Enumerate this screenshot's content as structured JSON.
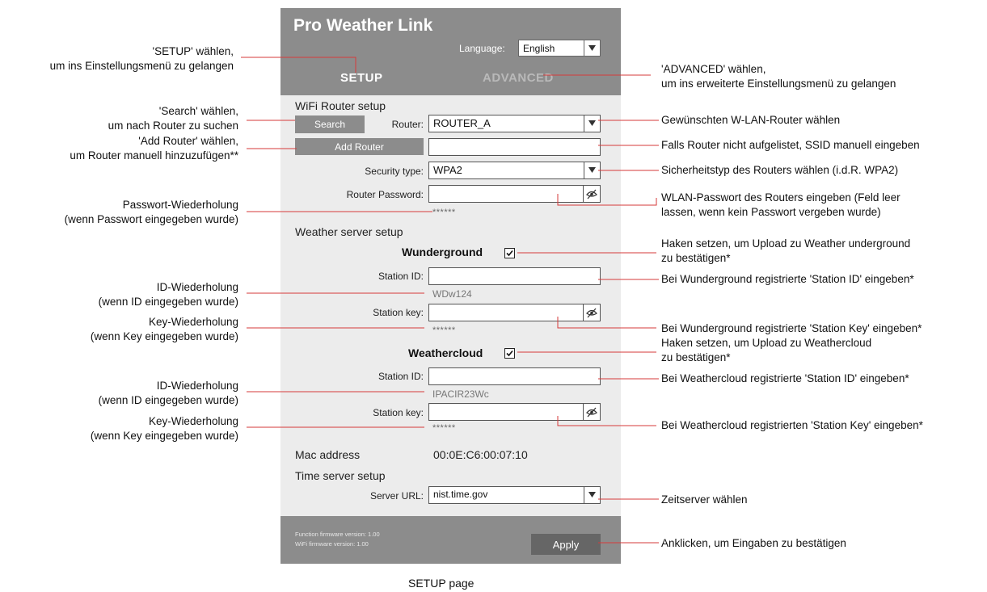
{
  "panel": {
    "title": "Pro Weather Link",
    "language_label": "Language:",
    "language_value": "English",
    "tabs": {
      "setup": "SETUP",
      "advanced": "ADVANCED"
    },
    "wifi": {
      "heading": "WiFi Router setup",
      "search_button": "Search",
      "router_label": "Router:",
      "router_value": "ROUTER_A",
      "add_router_button": "Add Router",
      "ssid_value": "",
      "security_label": "Security type:",
      "security_value": "WPA2",
      "password_label": "Router Password:",
      "password_echo": "******"
    },
    "weather": {
      "heading": "Weather server setup",
      "wunderground": {
        "name": "Wunderground",
        "checked": true,
        "station_id_label": "Station ID:",
        "station_id_echo": "WDw124",
        "station_key_label": "Station key:",
        "station_key_echo": "******"
      },
      "weathercloud": {
        "name": "Weathercloud",
        "checked": true,
        "station_id_label": "Station ID:",
        "station_id_echo": "IPACIR23Wc",
        "station_key_label": "Station key:",
        "station_key_echo": "******"
      }
    },
    "mac": {
      "label": "Mac address",
      "value": "00:0E:C6:00:07:10"
    },
    "time": {
      "heading": "Time server setup",
      "server_label": "Server URL:",
      "server_value": "nist.time.gov"
    },
    "footer": {
      "function_fw": "Function firmware version: 1.00",
      "wifi_fw": "WiFi firmware version: 1.00",
      "apply_button": "Apply"
    }
  },
  "annotations": {
    "left": {
      "setup": [
        "'SETUP' wählen,",
        "um ins Einstellungsmenü zu gelangen"
      ],
      "search": [
        "'Search' wählen,",
        "um nach Router zu suchen"
      ],
      "add_router": [
        "'Add Router' wählen,",
        "um Router manuell hinzuzufügen**"
      ],
      "password_repeat": [
        "Passwort-Wiederholung",
        "(wenn Passwort eingegeben wurde)"
      ],
      "wu_id_repeat": [
        "ID-Wiederholung",
        "(wenn ID eingegeben wurde)"
      ],
      "wu_key_repeat": [
        "Key-Wiederholung",
        "(wenn Key eingegeben wurde)"
      ],
      "wc_id_repeat": [
        "ID-Wiederholung",
        "(wenn ID eingegeben wurde)"
      ],
      "wc_key_repeat": [
        "Key-Wiederholung",
        "(wenn Key eingegeben wurde)"
      ]
    },
    "right": {
      "advanced": [
        "'ADVANCED' wählen,",
        "um ins erweiterte Einstellungsmenü zu gelangen"
      ],
      "router": [
        "Gewünschten W-LAN-Router wählen"
      ],
      "ssid": [
        "Falls Router nicht aufgelistet, SSID manuell eingeben"
      ],
      "security": [
        "Sicherheitstyp des Routers wählen (i.d.R. WPA2)"
      ],
      "password": [
        "WLAN-Passwort des Routers eingeben (Feld leer",
        "lassen, wenn kein Passwort vergeben wurde)"
      ],
      "wu_check": [
        "Haken setzen, um Upload zu Weather underground",
        "zu bestätigen*"
      ],
      "wu_id": [
        "Bei Wunderground registrierte 'Station ID' eingeben*"
      ],
      "wu_key": [
        "Bei Wunderground registrierte 'Station Key' eingeben*"
      ],
      "wc_check": [
        "Haken setzen, um Upload zu Weathercloud",
        "zu bestätigen*"
      ],
      "wc_id": [
        "Bei Weathercloud registrierte 'Station ID' eingeben*"
      ],
      "wc_key": [
        "Bei Weathercloud registrierten 'Station Key' eingeben*"
      ],
      "time_server": [
        "Zeitserver wählen"
      ],
      "apply": [
        "Anklicken, um Eingaben zu bestätigen"
      ]
    },
    "caption": "SETUP page",
    "line_color": "#d63a3a"
  }
}
